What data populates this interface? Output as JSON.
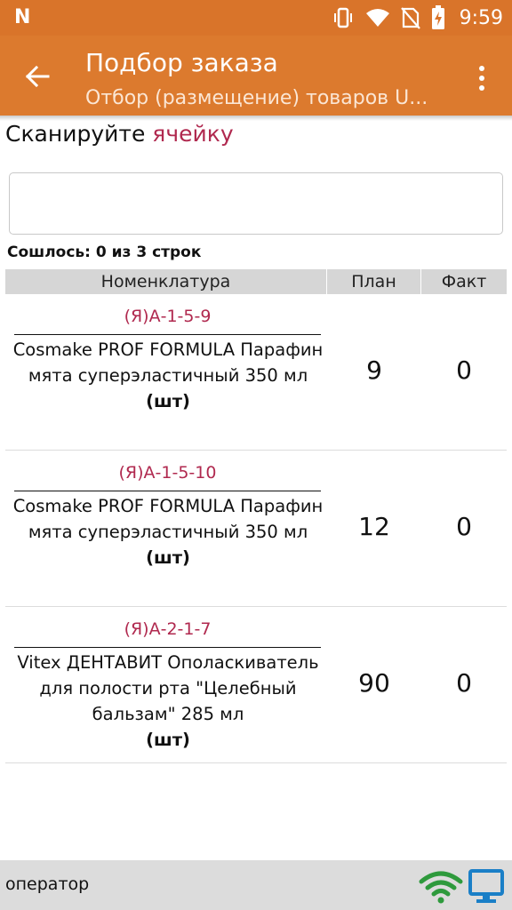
{
  "status_bar": {
    "logo": "N",
    "time": "9:59",
    "icons": [
      "n-logo-icon",
      "vibrate-icon",
      "wifi-icon",
      "no-sim-icon",
      "battery-charging-icon"
    ]
  },
  "app_bar": {
    "title": "Подбор заказа",
    "subtitle": "Отбор (размещение) товаров U...",
    "back_icon": "arrow-back-icon",
    "menu_icon": "more-vert-icon"
  },
  "prompt": {
    "text": "Сканируйте ",
    "highlight": "ячейку",
    "highlight_color": "#b0294f"
  },
  "scan_input": {
    "value": "",
    "placeholder": ""
  },
  "match_status": "Сошлось: 0 из 3 строк",
  "table": {
    "columns": [
      "Номенклатура",
      "План",
      "Факт"
    ],
    "rows": [
      {
        "cell": "(Я)А-1-5-9",
        "desc": "Cosmake PROF FORMULA Парафин мята суперэластичный 350 мл",
        "unit": "(шт)",
        "plan": "9",
        "fact": "0"
      },
      {
        "cell": "(Я)А-1-5-10",
        "desc": "Cosmake PROF FORMULA Парафин мята суперэластичный 350 мл",
        "unit": "(шт)",
        "plan": "12",
        "fact": "0"
      },
      {
        "cell": "(Я)А-2-1-7",
        "desc": "Vitex ДЕНТАВИТ Ополаскиватель для полости рта \"Целебный бальзам\" 285 мл",
        "unit": "(шт)",
        "plan": "90",
        "fact": "0"
      }
    ]
  },
  "bottom_bar": {
    "operator": "оператор",
    "icons": [
      "wifi-signal-icon",
      "monitor-icon"
    ],
    "wifi_color": "#2e9a3c",
    "monitor_color": "#1a7fc7"
  },
  "colors": {
    "app_bar": "#dc7a2e",
    "status_bar": "#d9742a",
    "accent": "#b0294f"
  }
}
